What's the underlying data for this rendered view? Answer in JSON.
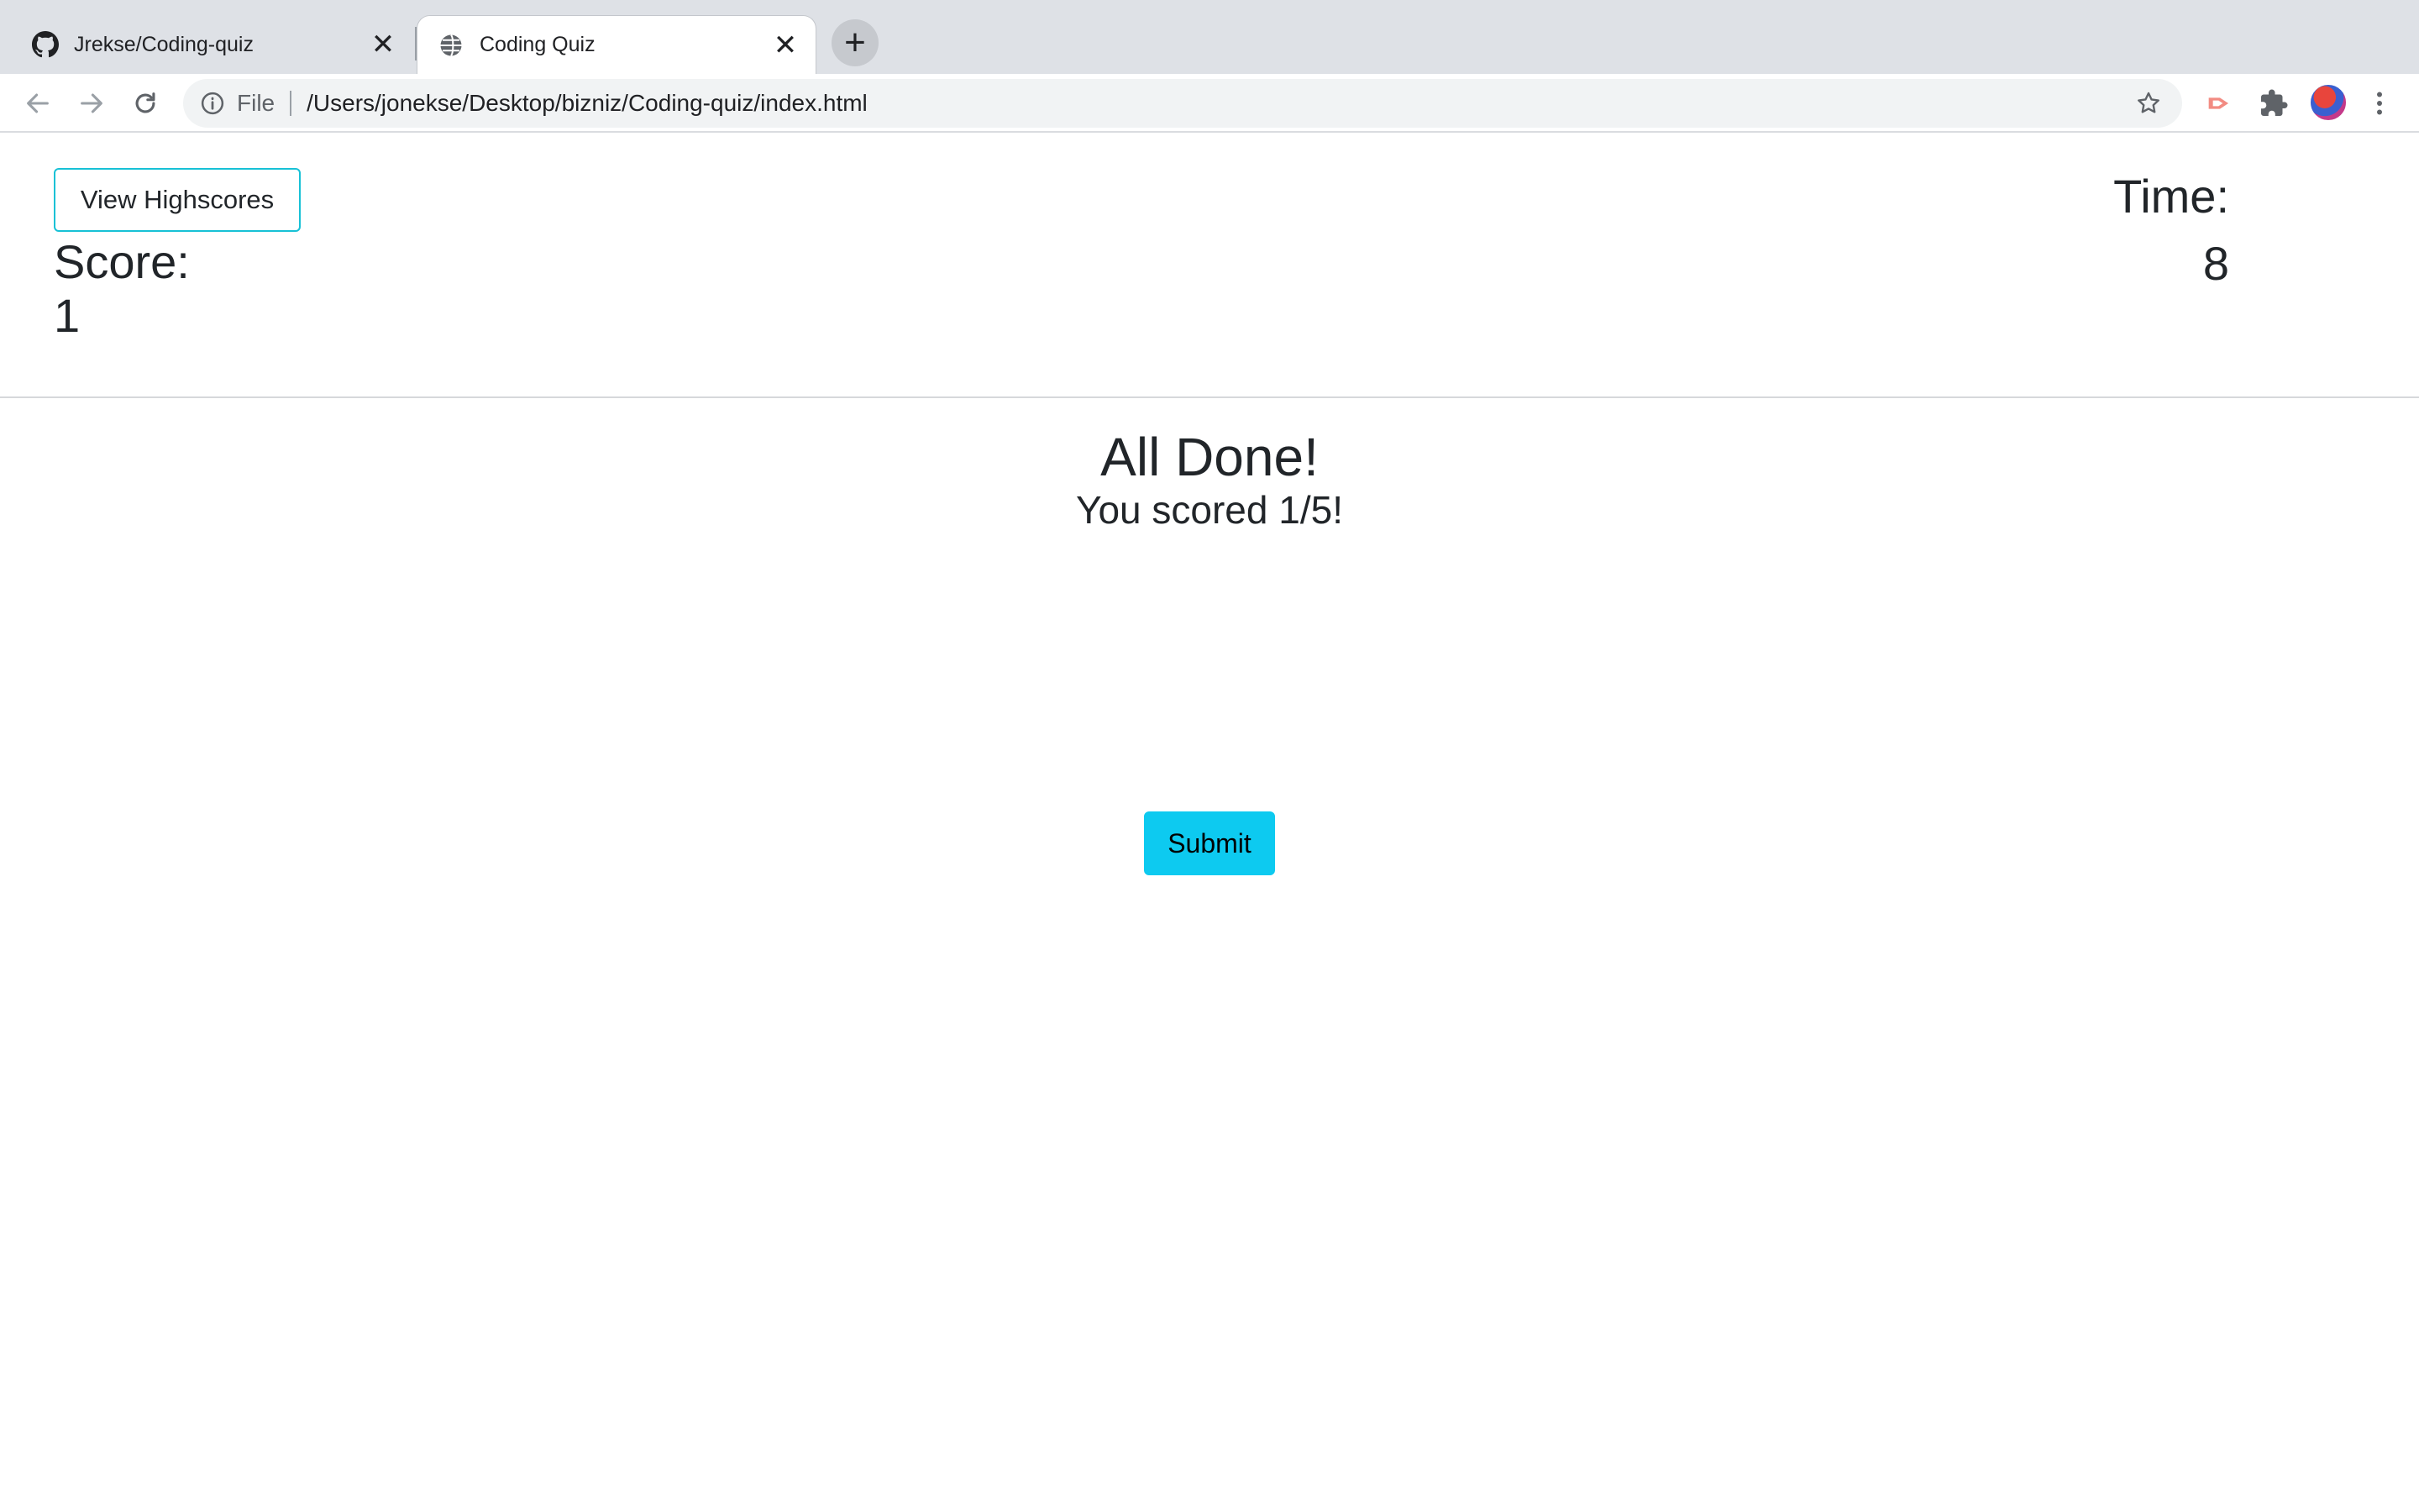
{
  "browser": {
    "tabs": [
      {
        "title": "Jrekse/Coding-quiz",
        "icon": "github-icon",
        "active": false
      },
      {
        "title": "Coding Quiz",
        "icon": "globe-icon",
        "active": true
      }
    ],
    "new_tab_label": "+",
    "close_glyph": "✕",
    "omnibox": {
      "scheme": "File",
      "url": "/Users/jonekse/Desktop/bizniz/Coding-quiz/index.html"
    },
    "colors": {
      "tabstrip": "#dee1e6",
      "omnibox": "#f1f3f4"
    }
  },
  "page": {
    "highscores_label": "View Highscores",
    "score_label": "Score:",
    "score_value": "1",
    "time_label": "Time:",
    "time_value": "8",
    "done_title": "All Done!",
    "done_score": "You scored 1/5!",
    "submit_label": "Submit",
    "colors": {
      "accent": "#0dcaf0",
      "outline": "#17c1d6",
      "text": "#212529"
    }
  }
}
